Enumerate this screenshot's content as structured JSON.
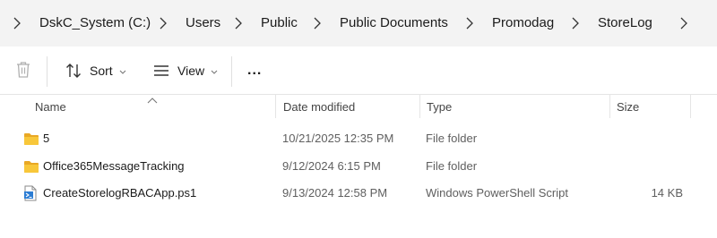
{
  "breadcrumb": {
    "items": [
      "DskC_System (C:)",
      "Users",
      "Public",
      "Public Documents",
      "Promodag",
      "StoreLog"
    ]
  },
  "toolbar": {
    "sort_label": "Sort",
    "view_label": "View",
    "more_label": "..."
  },
  "columns": {
    "name": "Name",
    "date_modified": "Date modified",
    "type": "Type",
    "size": "Size"
  },
  "files": [
    {
      "name": "5",
      "date": "10/21/2025 12:35 PM",
      "type": "File folder",
      "size": "",
      "icon": "folder-icon"
    },
    {
      "name": "Office365MessageTracking",
      "date": "9/12/2024 6:15 PM",
      "type": "File folder",
      "size": "",
      "icon": "folder-icon"
    },
    {
      "name": "CreateStorelogRBACApp.ps1",
      "date": "9/13/2024 12:58 PM",
      "type": "Windows PowerShell Script",
      "size": "14 KB",
      "icon": "powershell-script-icon"
    }
  ],
  "colors": {
    "folder": "#f8c73a",
    "folder_dark": "#e9a825",
    "script_blue": "#2b7cd3",
    "address_bar_bg": "#f3f3f3"
  }
}
